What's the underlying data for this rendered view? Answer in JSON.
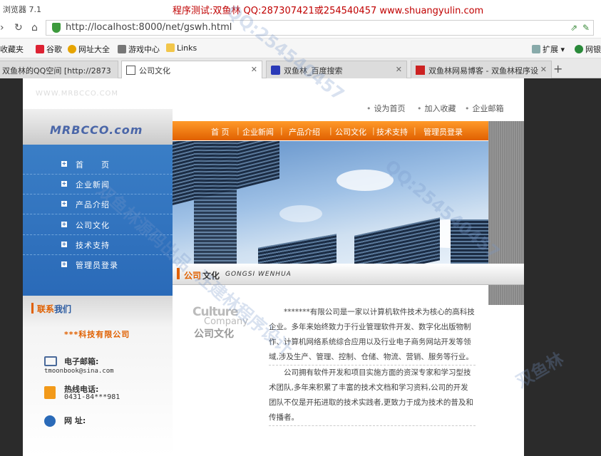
{
  "browser": {
    "app_name": "浏览器 7.1",
    "top_banner": "程序测试:双鱼林 QQ:287307421或254540457 www.shuangyulin.com",
    "url": "http://localhost:8000/net/gswh.html"
  },
  "bookmarks": [
    {
      "label": "收藏夹",
      "icon": "star-icon"
    },
    {
      "label": "谷歌",
      "icon": "paw-icon"
    },
    {
      "label": "网址大全",
      "icon": "globe-icon"
    },
    {
      "label": "游戏中心",
      "icon": "gamepad-icon"
    },
    {
      "label": "Links",
      "icon": "folder-icon"
    },
    {
      "label": "扩展",
      "icon": "grid-icon"
    },
    {
      "label": "网银",
      "icon": "bank-icon"
    }
  ],
  "tabs": [
    {
      "label": "双鱼林的QQ空间 [http://2873",
      "active": false
    },
    {
      "label": "公司文化",
      "active": true
    },
    {
      "label": "双鱼林_百度搜索",
      "active": false
    },
    {
      "label": "双鱼林网易博客 - 双鱼林程序设",
      "active": false
    }
  ],
  "site": {
    "faint_url": "WWW.MRBCCO.COM",
    "top_links": [
      "设为首页",
      "加入收藏",
      "企业邮箱"
    ],
    "logo": "MRBCCO.com",
    "menu": [
      "首 页",
      "企业新闻",
      "产品介绍",
      "公司文化",
      "技术支持",
      "管理员登录"
    ],
    "side_menu": [
      "首　　页",
      "企业新闻",
      "产品介绍",
      "公司文化",
      "技术支持",
      "管理员登录"
    ],
    "content_title_a": "公司",
    "content_title_b": "文化",
    "content_title_en": "GONGSI WENHUA",
    "culture_logo": {
      "line1": "Culture",
      "line2": "Company",
      "line3": "公司文化"
    },
    "paragraphs": [
      "*******有限公司是一家以计算机软件技术为核心的高科技企业。多年来始终致力于行业管理软件开发、数字化出版物制作、计算机网络系统综合应用以及行业电子商务网站开发等领域,涉及生产、管理、控制、仓储、物流、营销、服务等行业。",
      "公司拥有软件开发和项目实施方面的资深专家和学习型技术团队,多年来积累了丰富的技术文档和学习资料,公司的开发团队不仅是开拓进取的技术实践者,更致力于成为技术的普及和传播者。"
    ],
    "contact": {
      "title_a": "联系",
      "title_b": "我们",
      "company": "***科技有限公司",
      "email_label": "电子邮箱:",
      "email": "tmoonbook@sina.com",
      "phone_label": "热线电话:",
      "phone": "0431-84***981",
      "web_label": "网 址:"
    }
  },
  "watermarks": [
    "QQ:254540457",
    "双鱼林源码出品",
    "汪建林程序设计",
    "QQ:254540457",
    "双鱼林"
  ]
}
